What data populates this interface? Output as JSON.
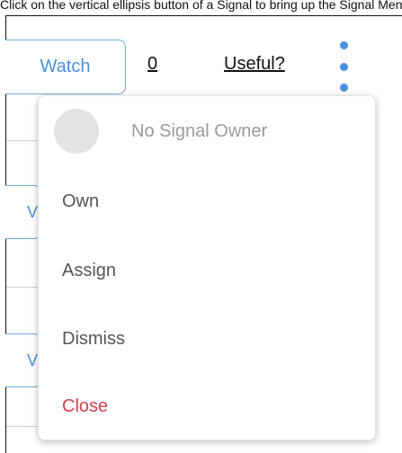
{
  "instruction": {
    "text": "Click on the vertical ellipsis button of a Signal to bring up the Signal Menu"
  },
  "signal_row": {
    "watch_label": "Watch",
    "count": "0",
    "useful_label": "Useful?"
  },
  "background_rows": {
    "partial_label_1": "V",
    "partial_label_2": "V"
  },
  "menu": {
    "owner_text": "No Signal Owner",
    "items": [
      {
        "label": "Own"
      },
      {
        "label": "Assign"
      },
      {
        "label": "Dismiss"
      },
      {
        "label": "Close"
      }
    ]
  },
  "colors": {
    "accent": "#4a90e2",
    "close": "#d0424c"
  },
  "icons": {
    "kebab": "vertical-ellipsis-icon",
    "avatar": "avatar-placeholder"
  }
}
